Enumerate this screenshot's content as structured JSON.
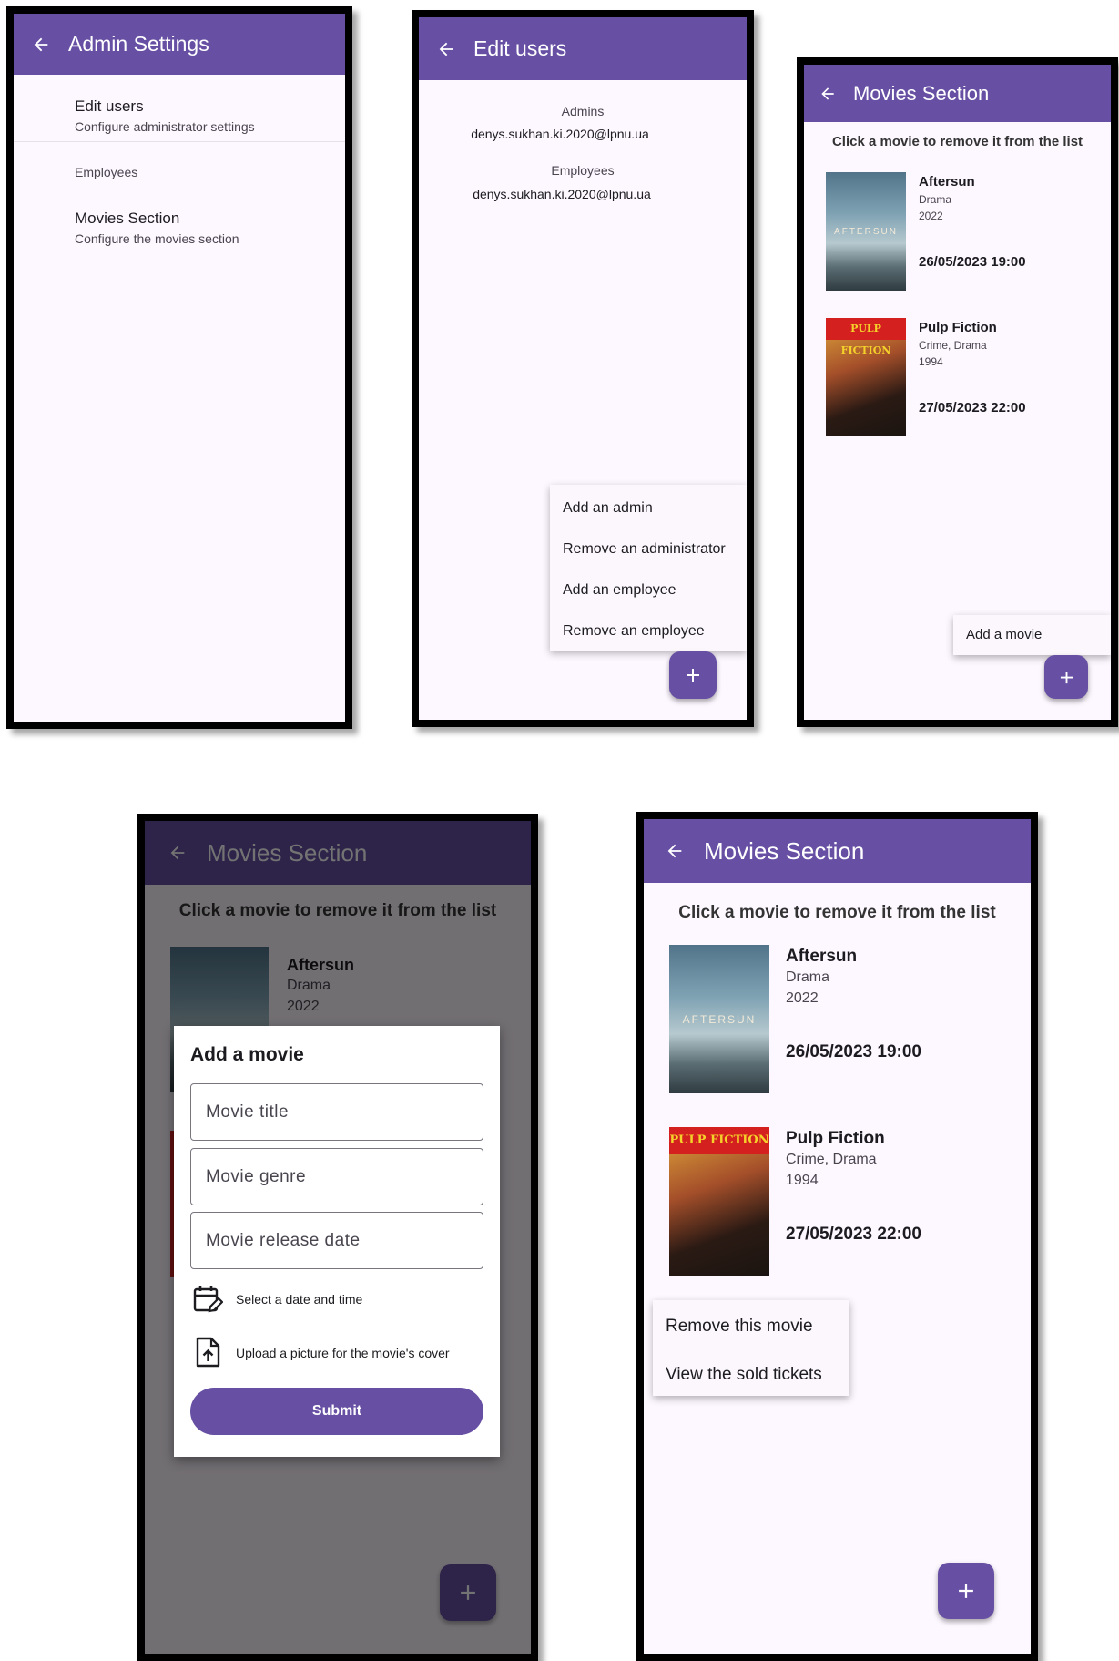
{
  "screen1": {
    "title": "Admin Settings",
    "items": [
      {
        "title": "Edit users",
        "subtitle": "Configure administrator settings"
      },
      {
        "section": "Employees"
      },
      {
        "title": "Movies Section",
        "subtitle": "Configure the movies section"
      }
    ]
  },
  "screen2": {
    "title": "Edit users",
    "admins_label": "Admins",
    "admin_email": "denys.sukhan.ki.2020@lpnu.ua",
    "employees_label": "Employees",
    "employee_email": "denys.sukhan.ki.2020@lpnu.ua",
    "menu": [
      "Add an admin",
      "Remove an administrator",
      "Add an employee",
      "Remove an employee"
    ],
    "fab": "+"
  },
  "movies_screen": {
    "title": "Movies Section",
    "hint": "Click a movie to remove it from the list",
    "movies": [
      {
        "title": "Aftersun",
        "genre": "Drama",
        "year": "2022",
        "showtime": "26/05/2023 19:00",
        "poster_text": "AFTERSUN"
      },
      {
        "title": "Pulp Fiction",
        "genre": "Crime, Drama",
        "year": "1994",
        "showtime": "27/05/2023 22:00",
        "poster_text": "PULP FICTION"
      }
    ],
    "add_menu_item": "Add a movie",
    "fab": "+"
  },
  "dialog": {
    "title": "Add a movie",
    "title_placeholder": "Movie title",
    "genre_placeholder": "Movie genre",
    "date_placeholder": "Movie release date",
    "select_date": "Select a date and time",
    "upload_picture": "Upload a picture for the movie's cover",
    "submit": "Submit"
  },
  "context_menu": [
    "Remove this movie",
    "View the sold tickets"
  ],
  "colors": {
    "primary": "#6750a4",
    "surface": "#fdf7ff",
    "poster_red": "#d4201f",
    "poster_yellow": "#f5d22a"
  },
  "icons": [
    "arrow-back-icon",
    "plus-icon",
    "calendar-edit-icon",
    "file-upload-icon"
  ]
}
